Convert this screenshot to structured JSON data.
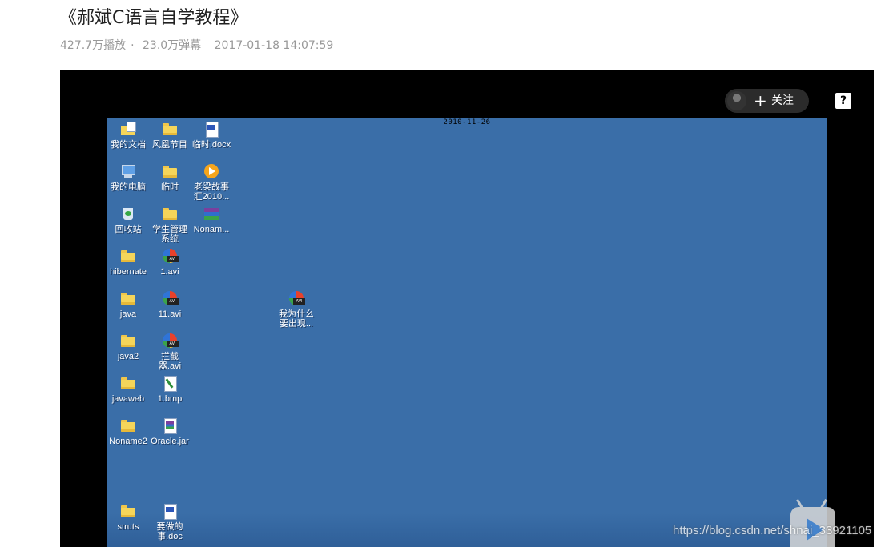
{
  "video": {
    "title": "《郝斌C语言自学教程》",
    "plays": "427.7万播放",
    "separator": "·",
    "danmaku": "23.0万弹幕",
    "timestamp": "2017-01-18 14:07:59"
  },
  "player": {
    "follow_label": "关注",
    "help_glyph": "?",
    "watermark": "https://blog.csdn.net/shnai_33921105"
  },
  "desktop": {
    "date": "2010-11-26",
    "icons": [
      {
        "label": "我的文档",
        "icon": "my-documents-icon"
      },
      {
        "label": "风凰节目",
        "icon": "folder-icon"
      },
      {
        "label": "临时.docx",
        "icon": "word-document-icon"
      },
      {
        "label": "我的电脑",
        "icon": "my-computer-icon"
      },
      {
        "label": "临时",
        "icon": "folder-icon"
      },
      {
        "label": "老梁故事汇2010...",
        "icon": "media-player-icon"
      },
      {
        "label": "回收站",
        "icon": "recycle-bin-icon"
      },
      {
        "label": "学生管理系统",
        "icon": "folder-icon"
      },
      {
        "label": "Nonam...",
        "icon": "rar-archive-icon"
      },
      {
        "label": "hibernate",
        "icon": "folder-icon"
      },
      {
        "label": "1.avi",
        "icon": "avi-video-icon"
      },
      {
        "label": "java",
        "icon": "folder-icon"
      },
      {
        "label": "11.avi",
        "icon": "avi-video-icon"
      },
      {
        "label": "我为什么要出现...",
        "icon": "avi-video-icon"
      },
      {
        "label": "java2",
        "icon": "folder-icon"
      },
      {
        "label": "拦截器.avi",
        "icon": "avi-video-icon"
      },
      {
        "label": "javaweb",
        "icon": "folder-icon"
      },
      {
        "label": "1.bmp",
        "icon": "bitmap-image-icon"
      },
      {
        "label": "Noname2",
        "icon": "folder-icon"
      },
      {
        "label": "Oracle.jar",
        "icon": "jar-archive-icon"
      },
      {
        "label": "struts",
        "icon": "folder-icon"
      },
      {
        "label": "要做的事.doc",
        "icon": "word-document-icon"
      }
    ]
  }
}
